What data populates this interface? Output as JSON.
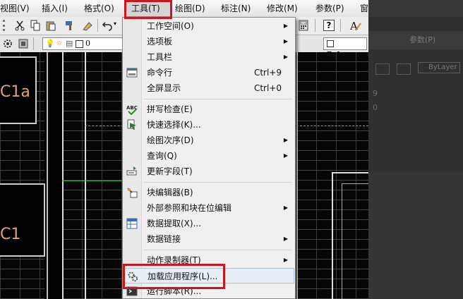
{
  "menubar": {
    "items": [
      {
        "label": "视图(V)"
      },
      {
        "label": "插入(I)"
      },
      {
        "label": "格式(O)"
      },
      {
        "label": "工具(T)"
      },
      {
        "label": "绘图(D)"
      },
      {
        "label": "标注(N)"
      },
      {
        "label": "修改(M)"
      },
      {
        "label": "参数(P)"
      },
      {
        "label": "窗"
      }
    ]
  },
  "toolbar": {
    "layer_value": "0",
    "color_value": "ByLayer"
  },
  "canvas": {
    "label_1": "C1a",
    "label_2": "C1"
  },
  "right_panel": {
    "menu_text": "参数(P)",
    "combo_value": "ByLayer",
    "num_1": "9",
    "num_2": "0"
  },
  "tools_menu": {
    "items": [
      {
        "label": "工作空间(O)",
        "submenu": true
      },
      {
        "label": "选项板",
        "submenu": true
      },
      {
        "label": "工具栏",
        "submenu": true
      },
      {
        "label": "命令行",
        "shortcut": "Ctrl+9",
        "icon": "command-line-icon"
      },
      {
        "label": "全屏显示",
        "shortcut": "Ctrl+0"
      },
      {
        "label": "拼写检查(E)",
        "icon": "spell-check-icon",
        "icon_text": "ABC"
      },
      {
        "label": "快速选择(K)...",
        "icon": "quick-select-icon"
      },
      {
        "label": "绘图次序(D)",
        "submenu": true
      },
      {
        "label": "查询(Q)",
        "submenu": true
      },
      {
        "label": "更新字段(T)",
        "icon": "update-field-icon"
      },
      {
        "label": "块编辑器(B)",
        "icon": "block-editor-icon"
      },
      {
        "label": "外部参照和块在位编辑",
        "submenu": true
      },
      {
        "label": "数据提取(X)...",
        "icon": "data-extraction-icon"
      },
      {
        "label": "数据链接",
        "submenu": true
      },
      {
        "label": "动作录制器(T)",
        "submenu": true
      },
      {
        "label": "加载应用程序(L)...",
        "icon": "load-application-icon"
      },
      {
        "label": "运行脚本(R)...",
        "icon": "run-script-icon"
      }
    ]
  },
  "colors": {
    "highlight_border": "#c8171d",
    "label_color": "#e0a27c"
  }
}
